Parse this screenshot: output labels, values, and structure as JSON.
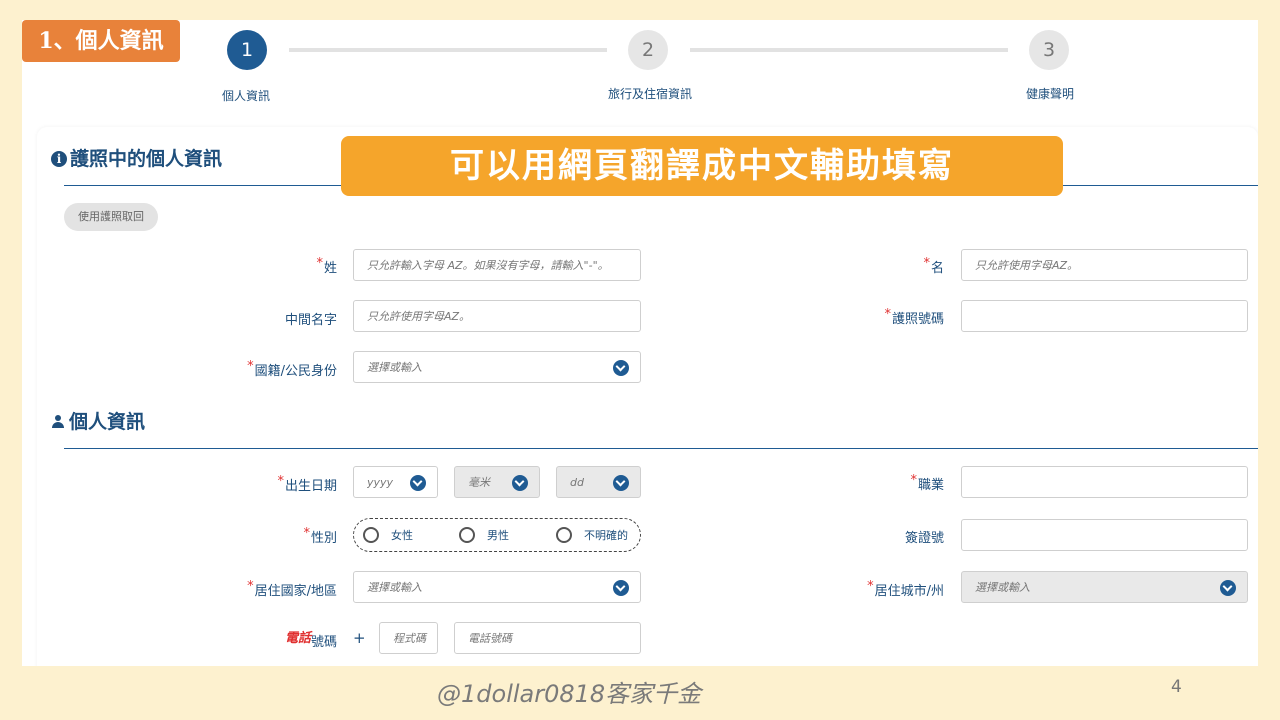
{
  "tag": "1、個人資訊",
  "banner": "可以用網頁翻譯成中文輔助填寫",
  "stepper": [
    {
      "num": "1",
      "label": "個人資訊"
    },
    {
      "num": "2",
      "label": "旅行及住宿資訊"
    },
    {
      "num": "3",
      "label": "健康聲明"
    }
  ],
  "passport_section": {
    "title": "護照中的個人資訊",
    "use_passport_button": "使用護照取回",
    "surname_label": "姓",
    "surname_placeholder": "只允許輸入字母 AZ。如果沒有字母，請輸入\"-\"。",
    "given_name_label": "名",
    "given_name_placeholder": "只允許使用字母AZ。",
    "middle_name_label": "中間名字",
    "middle_name_placeholder": "只允許使用字母AZ。",
    "passport_no_label": "護照號碼",
    "nationality_label": "國籍/公民身份",
    "nationality_placeholder": "選擇或輸入"
  },
  "personal_section": {
    "title": "個人資訊",
    "dob_label": "出生日期",
    "dob_year": "yyyy",
    "dob_month": "毫米",
    "dob_day": "dd",
    "occupation_label": "職業",
    "gender_label": "性別",
    "gender_options": [
      "女性",
      "男性",
      "不明確的"
    ],
    "visa_no_label": "簽證號",
    "residence_country_label": "居住國家/地區",
    "residence_country_placeholder": "選擇或輸入",
    "residence_city_label": "居住城市/州",
    "residence_city_placeholder": "選擇或輸入",
    "phone_label_red": "電話",
    "phone_label_rest": "號碼",
    "phone_plus": "+",
    "phone_code_placeholder": "程式碼",
    "phone_number_placeholder": "電話號碼"
  },
  "footer": {
    "watermark": "@1dollar0818客家千金",
    "page": "4"
  },
  "colors": {
    "background": "#fdf1cf",
    "tag": "#e8823a",
    "banner": "#f5a52b",
    "primary": "#1f5b93",
    "required": "#e03030"
  }
}
